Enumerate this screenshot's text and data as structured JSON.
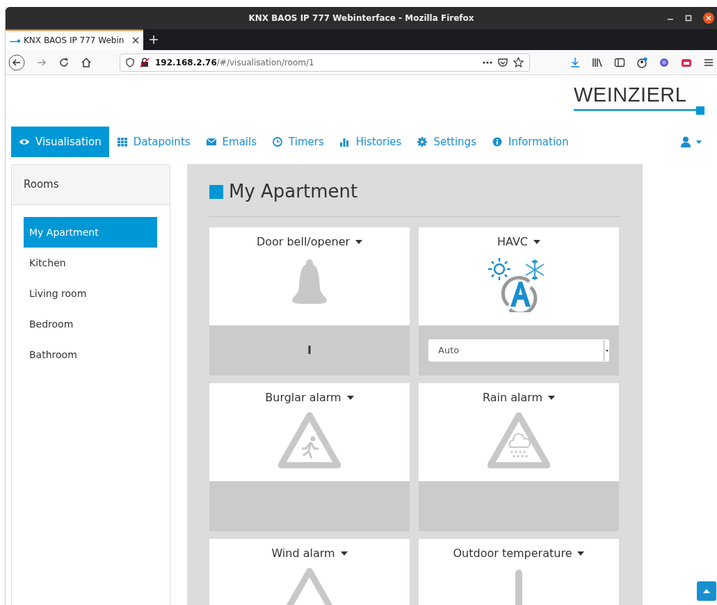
{
  "window": {
    "title": "KNX BAOS IP 777 Webinterface - Mozilla Firefox"
  },
  "browser_tab": {
    "title": "KNX BAOS IP 777 Webin"
  },
  "address": {
    "host": "192.168.2.76",
    "path": "/#/visualisation/room/1"
  },
  "logo": "WEINZIERL",
  "nav": [
    {
      "label": "Visualisation",
      "selected": true
    },
    {
      "label": "Datapoints",
      "selected": false
    },
    {
      "label": "Emails",
      "selected": false
    },
    {
      "label": "Timers",
      "selected": false
    },
    {
      "label": "Histories",
      "selected": false
    },
    {
      "label": "Settings",
      "selected": false
    },
    {
      "label": "Information",
      "selected": false
    }
  ],
  "sidebar": {
    "title": "Rooms",
    "items": [
      {
        "label": "My Apartment",
        "selected": true
      },
      {
        "label": "Kitchen",
        "selected": false
      },
      {
        "label": "Living room",
        "selected": false
      },
      {
        "label": "Bedroom",
        "selected": false
      },
      {
        "label": "Bathroom",
        "selected": false
      }
    ]
  },
  "room": {
    "title": "My Apartment"
  },
  "widgets": [
    {
      "title": "Door bell/opener",
      "kind": "bell",
      "value": "I"
    },
    {
      "title": "HAVC",
      "kind": "havc",
      "value": "Auto"
    },
    {
      "title": "Burglar alarm",
      "kind": "burglar"
    },
    {
      "title": "Rain alarm",
      "kind": "rain"
    },
    {
      "title": "Wind alarm",
      "kind": "wind"
    },
    {
      "title": "Outdoor temperature",
      "kind": "thermometer"
    }
  ]
}
